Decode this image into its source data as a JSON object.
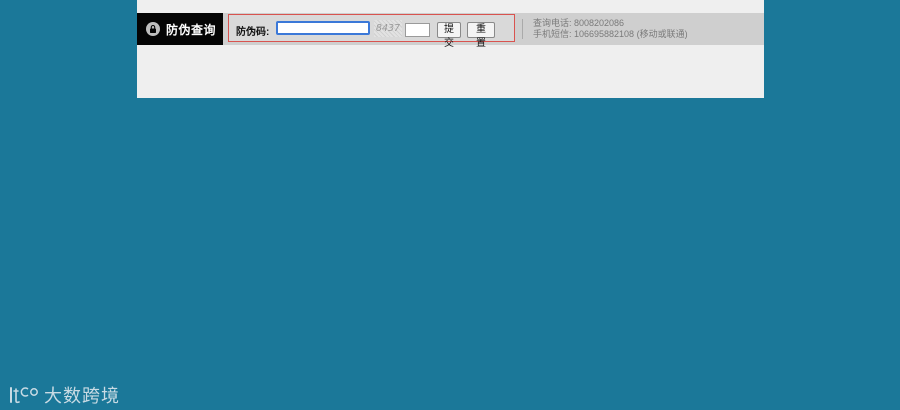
{
  "header": {
    "brand_title": "防伪查询",
    "brand_icon": "lock-icon"
  },
  "form": {
    "label": "防伪码:",
    "code_value": "",
    "captcha_text": "8437",
    "captcha_value": "",
    "submit_label": "提交",
    "reset_label": "重 置"
  },
  "contact": {
    "phone": "查询电话: 8008202086",
    "sms": "手机短信: 106695882108 (移动或联通)"
  },
  "watermark": {
    "logo_text": "tCO",
    "text": "大数跨境"
  },
  "colors": {
    "background": "#1b7899",
    "panel": "#efefef",
    "bar": "#cfcfcf",
    "brand_bg": "#050505",
    "form_border": "#d9534f",
    "input_focus": "#3b78d8"
  }
}
